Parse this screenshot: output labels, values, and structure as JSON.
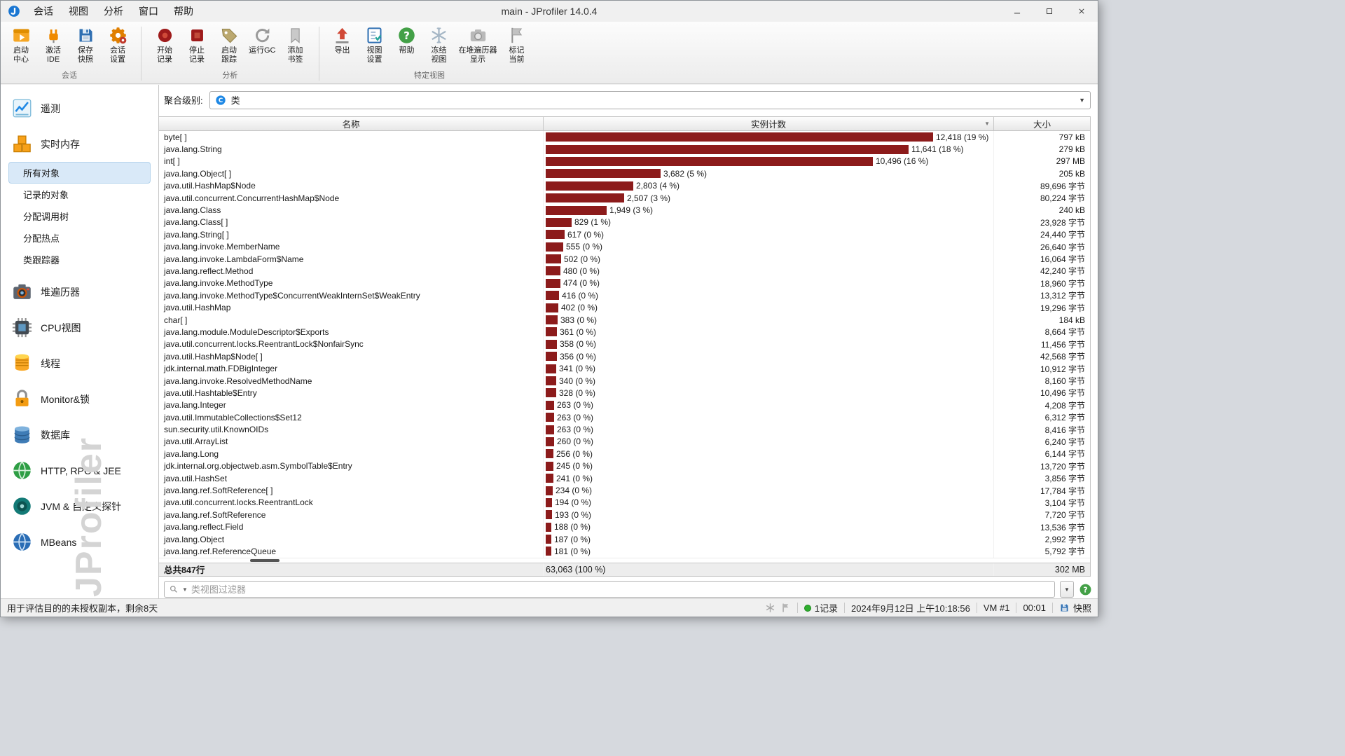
{
  "titlebar": {
    "title": "main - JProfiler 14.0.4",
    "menus": [
      "会话",
      "视图",
      "分析",
      "窗口",
      "帮助"
    ]
  },
  "toolbar": {
    "groups": [
      {
        "label": "会话",
        "buttons": [
          {
            "id": "start-center",
            "icon": "start-center",
            "lines": [
              "启动",
              "中心"
            ]
          },
          {
            "id": "activate-ide",
            "icon": "activate-ide",
            "lines": [
              "激活",
              "IDE"
            ]
          },
          {
            "id": "save-snapshot",
            "icon": "save-snapshot",
            "lines": [
              "保存",
              "快照"
            ]
          },
          {
            "id": "session-settings",
            "icon": "session-settings",
            "lines": [
              "会话",
              "设置"
            ]
          }
        ]
      },
      {
        "label": "分析",
        "buttons": [
          {
            "id": "start-recording",
            "icon": "start-recording",
            "lines": [
              "开始",
              "记录"
            ]
          },
          {
            "id": "stop-recording",
            "icon": "stop-recording",
            "lines": [
              "停止",
              "记录"
            ]
          },
          {
            "id": "start-tracking",
            "icon": "start-tracking",
            "lines": [
              "启动",
              "跟踪"
            ]
          },
          {
            "id": "run-gc",
            "icon": "run-gc",
            "lines": [
              "运行GC"
            ]
          },
          {
            "id": "add-bookmark",
            "icon": "add-bookmark",
            "lines": [
              "添加",
              "书签"
            ]
          }
        ]
      },
      {
        "label": "特定视图",
        "buttons": [
          {
            "id": "export",
            "icon": "export",
            "lines": [
              "导出"
            ]
          },
          {
            "id": "view-settings",
            "icon": "view-settings",
            "lines": [
              "视图",
              "设置"
            ]
          },
          {
            "id": "help",
            "icon": "help",
            "lines": [
              "帮助"
            ]
          },
          {
            "id": "freeze-view",
            "icon": "freeze-view",
            "lines": [
              "冻结",
              "视图"
            ]
          },
          {
            "id": "show-in-heap-walker",
            "icon": "show-heap-walker",
            "lines": [
              "在堆遍历器",
              "显示"
            ]
          },
          {
            "id": "mark-current",
            "icon": "mark-current",
            "lines": [
              "标记",
              "当前"
            ]
          }
        ]
      }
    ]
  },
  "sidebar": {
    "watermark": "JProfiler",
    "items": [
      {
        "id": "telemetries",
        "icon": "telemetry",
        "label": "遥测"
      },
      {
        "id": "live-memory",
        "icon": "live-memory",
        "label": "实时内存",
        "children": [
          {
            "id": "all-objects",
            "label": "所有对象",
            "selected": true
          },
          {
            "id": "recorded-objects",
            "label": "记录的对象"
          },
          {
            "id": "allocation-call-tree",
            "label": "分配调用树"
          },
          {
            "id": "allocation-hotspots",
            "label": "分配热点"
          },
          {
            "id": "class-tracker",
            "label": "类跟踪器"
          }
        ]
      },
      {
        "id": "heap-walker",
        "icon": "heap-walker",
        "label": "堆遍历器"
      },
      {
        "id": "cpu-views",
        "icon": "cpu-views",
        "label": "CPU视图"
      },
      {
        "id": "threads",
        "icon": "threads",
        "label": "线程"
      },
      {
        "id": "monitors-locks",
        "icon": "monitors-locks",
        "label": "Monitor&锁"
      },
      {
        "id": "databases",
        "icon": "databases",
        "label": "数据库"
      },
      {
        "id": "http-rpc-jee",
        "icon": "http-rpc-jee",
        "label": "HTTP, RPC & JEE"
      },
      {
        "id": "jvm-probes",
        "icon": "jvm-probes",
        "label": "JVM & 自定义探针"
      },
      {
        "id": "mbeans",
        "icon": "mbeans",
        "label": "MBeans"
      }
    ]
  },
  "aggregation": {
    "label": "聚合级别:",
    "value": "类"
  },
  "table": {
    "columns": [
      "名称",
      "实例计数",
      "大小"
    ],
    "bar_color": "#8c1b1b",
    "rows": [
      {
        "name": "byte[ ]",
        "count": 12418,
        "count_label": "12,418 (19 %)",
        "size": "797 kB"
      },
      {
        "name": "java.lang.String",
        "count": 11641,
        "count_label": "11,641 (18 %)",
        "size": "279 kB"
      },
      {
        "name": "int[ ]",
        "count": 10496,
        "count_label": "10,496 (16 %)",
        "size": "297 MB"
      },
      {
        "name": "java.lang.Object[ ]",
        "count": 3682,
        "count_label": "3,682 (5 %)",
        "size": "205 kB"
      },
      {
        "name": "java.util.HashMap$Node",
        "count": 2803,
        "count_label": "2,803 (4 %)",
        "size": "89,696 字节"
      },
      {
        "name": "java.util.concurrent.ConcurrentHashMap$Node",
        "count": 2507,
        "count_label": "2,507 (3 %)",
        "size": "80,224 字节"
      },
      {
        "name": "java.lang.Class",
        "count": 1949,
        "count_label": "1,949 (3 %)",
        "size": "240 kB"
      },
      {
        "name": "java.lang.Class[ ]",
        "count": 829,
        "count_label": "829 (1 %)",
        "size": "23,928 字节"
      },
      {
        "name": "java.lang.String[ ]",
        "count": 617,
        "count_label": "617 (0 %)",
        "size": "24,440 字节"
      },
      {
        "name": "java.lang.invoke.MemberName",
        "count": 555,
        "count_label": "555 (0 %)",
        "size": "26,640 字节"
      },
      {
        "name": "java.lang.invoke.LambdaForm$Name",
        "count": 502,
        "count_label": "502 (0 %)",
        "size": "16,064 字节"
      },
      {
        "name": "java.lang.reflect.Method",
        "count": 480,
        "count_label": "480 (0 %)",
        "size": "42,240 字节"
      },
      {
        "name": "java.lang.invoke.MethodType",
        "count": 474,
        "count_label": "474 (0 %)",
        "size": "18,960 字节"
      },
      {
        "name": "java.lang.invoke.MethodType$ConcurrentWeakInternSet$WeakEntry",
        "count": 416,
        "count_label": "416 (0 %)",
        "size": "13,312 字节"
      },
      {
        "name": "java.util.HashMap",
        "count": 402,
        "count_label": "402 (0 %)",
        "size": "19,296 字节"
      },
      {
        "name": "char[ ]",
        "count": 383,
        "count_label": "383 (0 %)",
        "size": "184 kB"
      },
      {
        "name": "java.lang.module.ModuleDescriptor$Exports",
        "count": 361,
        "count_label": "361 (0 %)",
        "size": "8,664 字节"
      },
      {
        "name": "java.util.concurrent.locks.ReentrantLock$NonfairSync",
        "count": 358,
        "count_label": "358 (0 %)",
        "size": "11,456 字节"
      },
      {
        "name": "java.util.HashMap$Node[ ]",
        "count": 356,
        "count_label": "356 (0 %)",
        "size": "42,568 字节"
      },
      {
        "name": "jdk.internal.math.FDBigInteger",
        "count": 341,
        "count_label": "341 (0 %)",
        "size": "10,912 字节"
      },
      {
        "name": "java.lang.invoke.ResolvedMethodName",
        "count": 340,
        "count_label": "340 (0 %)",
        "size": "8,160 字节"
      },
      {
        "name": "java.util.Hashtable$Entry",
        "count": 328,
        "count_label": "328 (0 %)",
        "size": "10,496 字节"
      },
      {
        "name": "java.lang.Integer",
        "count": 263,
        "count_label": "263 (0 %)",
        "size": "4,208 字节"
      },
      {
        "name": "java.util.ImmutableCollections$Set12",
        "count": 263,
        "count_label": "263 (0 %)",
        "size": "6,312 字节"
      },
      {
        "name": "sun.security.util.KnownOIDs",
        "count": 263,
        "count_label": "263 (0 %)",
        "size": "8,416 字节"
      },
      {
        "name": "java.util.ArrayList",
        "count": 260,
        "count_label": "260 (0 %)",
        "size": "6,240 字节"
      },
      {
        "name": "java.lang.Long",
        "count": 256,
        "count_label": "256 (0 %)",
        "size": "6,144 字节"
      },
      {
        "name": "jdk.internal.org.objectweb.asm.SymbolTable$Entry",
        "count": 245,
        "count_label": "245 (0 %)",
        "size": "13,720 字节"
      },
      {
        "name": "java.util.HashSet",
        "count": 241,
        "count_label": "241 (0 %)",
        "size": "3,856 字节"
      },
      {
        "name": "java.lang.ref.SoftReference[ ]",
        "count": 234,
        "count_label": "234 (0 %)",
        "size": "17,784 字节"
      },
      {
        "name": "java.util.concurrent.locks.ReentrantLock",
        "count": 194,
        "count_label": "194 (0 %)",
        "size": "3,104 字节"
      },
      {
        "name": "java.lang.ref.SoftReference",
        "count": 193,
        "count_label": "193 (0 %)",
        "size": "7,720 字节"
      },
      {
        "name": "java.lang.reflect.Field",
        "count": 188,
        "count_label": "188 (0 %)",
        "size": "13,536 字节"
      },
      {
        "name": "java.lang.Object",
        "count": 187,
        "count_label": "187 (0 %)",
        "size": "2,992 字节"
      },
      {
        "name": "java.lang.ref.ReferenceQueue",
        "count": 181,
        "count_label": "181 (0 %)",
        "size": "5,792 字节"
      }
    ],
    "total": {
      "name": "总共847行",
      "count_label": "63,063 (100 %)",
      "size": "302 MB"
    }
  },
  "filter": {
    "placeholder": "类视图过滤器"
  },
  "statusbar": {
    "license": "用于评估目的的未授权副本，剩余8天",
    "recordings": "1记录",
    "datetime": "2024年9月12日 上午10:18:56",
    "vm": "VM #1",
    "elapsed": "00:01",
    "snapshot": "快照"
  }
}
